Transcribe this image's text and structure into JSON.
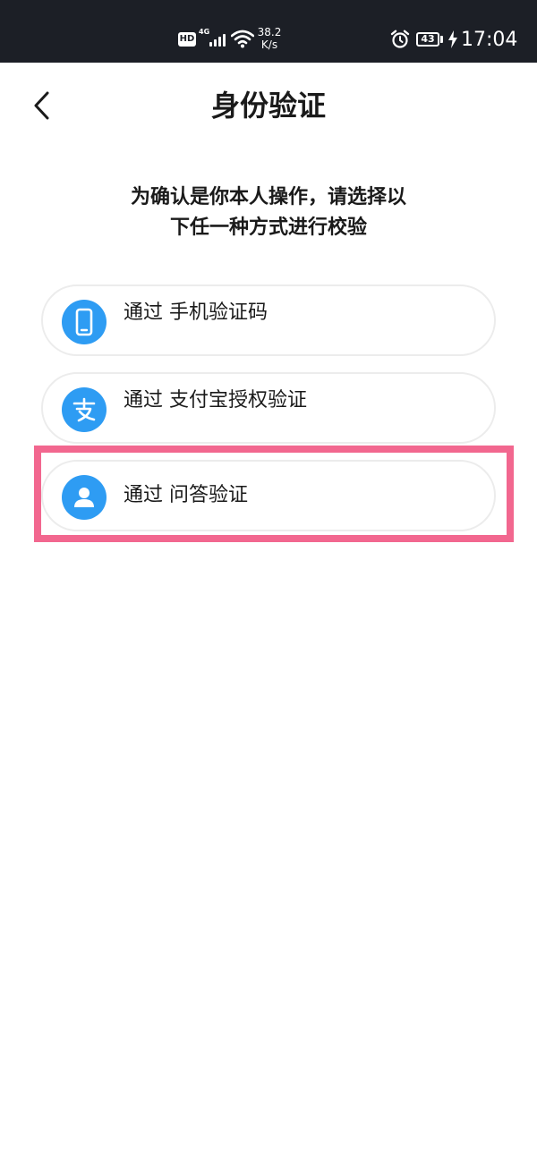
{
  "status_bar": {
    "hd": "HD",
    "network": "4G",
    "speed_value": "38.2",
    "speed_unit": "K/s",
    "battery": "43",
    "time": "17:04"
  },
  "header": {
    "title": "身份验证",
    "back_icon": "chevron-left-icon"
  },
  "instruction": {
    "line1": "为确认是你本人操作，请选择以",
    "line2": "下任一种方式进行校验"
  },
  "options": [
    {
      "label": "通过 手机验证码",
      "icon": "phone-icon",
      "color": "#2e9cf3"
    },
    {
      "label": "通过 支付宝授权验证",
      "icon": "alipay-icon",
      "color": "#2e9cf3"
    },
    {
      "label": "通过 问答验证",
      "icon": "person-icon",
      "color": "#2e9cf3"
    }
  ],
  "colors": {
    "status_bar_bg": "#1c1f26",
    "accent": "#2e9cf3",
    "highlight": "#f2678f",
    "border": "#ececec"
  }
}
